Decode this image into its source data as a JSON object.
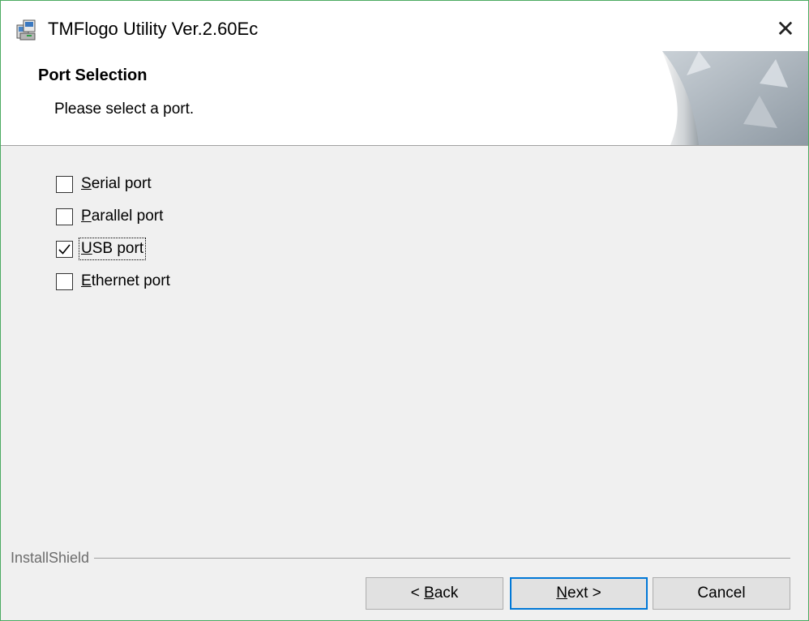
{
  "window": {
    "title": "TMFlogo Utility Ver.2.60Ec",
    "close_glyph": "✕",
    "icon": "installer-app-icon",
    "accent_border_color": "#4cab62"
  },
  "header": {
    "title": "Port Selection",
    "subtitle": "Please select a port."
  },
  "options": [
    {
      "pre": "",
      "key": "S",
      "post": "erial port",
      "checked": false
    },
    {
      "pre": "",
      "key": "P",
      "post": "arallel port",
      "checked": false
    },
    {
      "pre": "",
      "key": "U",
      "post": "SB port",
      "checked": true,
      "focused": true
    },
    {
      "pre": "",
      "key": "E",
      "post": "thernet port",
      "checked": false
    }
  ],
  "branding": {
    "label": "InstallShield"
  },
  "buttons": {
    "back": {
      "pre": "< ",
      "key": "B",
      "post": "ack"
    },
    "next": {
      "pre": "",
      "key": "N",
      "post": "ext >"
    },
    "cancel": {
      "label": "Cancel"
    }
  },
  "colors": {
    "focus_border": "#0078d7",
    "dialog_bg": "#f0f0f0"
  }
}
